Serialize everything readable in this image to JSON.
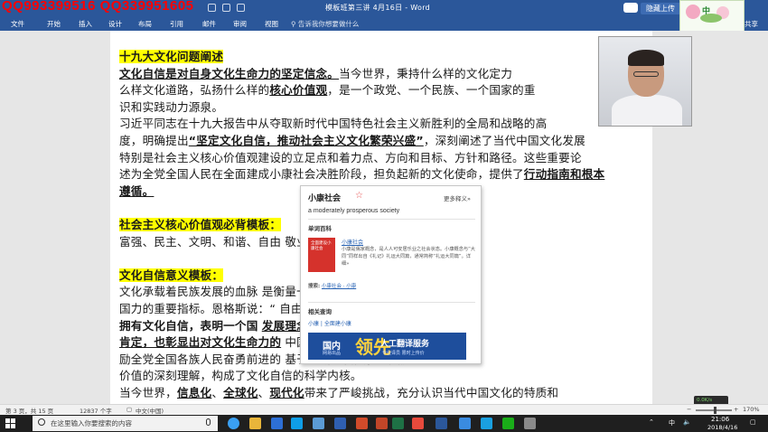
{
  "window": {
    "title": "模板班第三讲 4月16日 - Word",
    "watermark_qq": "QQ993399516  QQ339951605",
    "upload_label": "隐藏上传"
  },
  "ribbon": {
    "tabs": [
      "文件",
      "开始",
      "插入",
      "设计",
      "布局",
      "引用",
      "邮件",
      "审阅",
      "视图"
    ],
    "tell_me": "告诉我你想要做什么",
    "share": "共享"
  },
  "logo_text": "中",
  "document": {
    "lines": [
      [
        {
          "t": "十九大文化问题阐述",
          "s": "hl"
        }
      ],
      [
        {
          "t": "    "
        },
        {
          "t": "文化自信是对自身文化生命力的坚定信念。",
          "s": "b u"
        },
        {
          "t": "当今世界，秉持什么样的文化定力"
        }
      ],
      [
        {
          "t": "么样文化道路，弘扬什么样的"
        },
        {
          "t": "核心价值观",
          "s": "b u"
        },
        {
          "t": "，是一个政党、一个民族、一个国家的重"
        }
      ],
      [
        {
          "t": "识和实践动力源泉。"
        }
      ],
      [
        {
          "t": "    习近平同志在十九大报告中从夺取新时代中国特色社会主义新胜利的全局和战略的高"
        }
      ],
      [
        {
          "t": "度，明确提出"
        },
        {
          "t": "“坚定文化自信，推动社会主义文化繁荣兴盛”",
          "s": "b u"
        },
        {
          "t": "，深刻阐述了当代中国文化发展"
        }
      ],
      [
        {
          "t": "特别是社会主义核心价值观建设的立足点和着力点、方向和目标、方针和路径。这些重要论"
        }
      ],
      [
        {
          "t": "述为全党全国人民在全面建成小康社会决胜阶段，担负起新的文化使命，提供了"
        },
        {
          "t": "行动指南和根本",
          "s": "b u"
        }
      ],
      [
        {
          "t": "遵循。",
          "s": "b u"
        }
      ],
      [
        {
          "t": " "
        }
      ],
      [
        {
          "t": "社会主义核心价值观必背模板：",
          "s": "hl"
        }
      ],
      [
        {
          "t": "富强、民主、文明、和谐、自由                                  敬业、诚信、友善。"
        }
      ],
      [
        {
          "t": " "
        }
      ],
      [
        {
          "t": "    "
        },
        {
          "t": "文化自信意义模板：",
          "s": "hl"
        }
      ],
      [
        {
          "t": "    文化承载着民族发展的血脉                                  是衡量一个国家软实力和综合"
        }
      ],
      [
        {
          "t": "国力的重要指标。恩格斯说：“                                  自由的一步。”"
        }
      ],
      [
        {
          "t": "    "
        },
        {
          "t": "拥有文化自信，表明一个国",
          "s": "b"
        },
        {
          "t": "                              "
        },
        {
          "t": "发展理念、道路制度的充分",
          "s": "b u"
        }
      ],
      [
        {
          "t": "肯定，也彰显出对文化生命力的",
          "s": "b u"
        },
        {
          "t": "                              中国特色社会主义文化是激"
        }
      ],
      [
        {
          "t": "励全党全国各族人民奋勇前进的                              基于对新时代文化重大历史"
        }
      ],
      [
        {
          "t": "价值的深刻理解，构成了文化自信的科学内核。"
        }
      ],
      [
        {
          "t": "    当今世界，"
        },
        {
          "t": "信息化",
          "s": "b u"
        },
        {
          "t": "、"
        },
        {
          "t": "全球化",
          "s": "b u"
        },
        {
          "t": "、"
        },
        {
          "t": "现代化",
          "s": "b u"
        },
        {
          "t": "带来了严峻挑战，充分认识当代中国文化的特质和"
        }
      ]
    ]
  },
  "dictionary": {
    "word": "小康社会",
    "more": "更多释义»",
    "translation": "a moderately prosperous society",
    "section_baike": "单词百科",
    "image_caption": "全面建设小康社会",
    "entry_link": "小康社会",
    "entry_desc": "小康是儒家概念，是人人可安居乐业之社会状态。小康概念与“大同”同样出自《礼记》礼运大同篇，通常简称“礼运大同篇”。详细»",
    "source_label": "搜索:",
    "source_links": "小康社会 · 小康",
    "section_related": "相关查询",
    "related": "小康 | 全面建小康",
    "ad": {
      "left": "国内",
      "big": "领先",
      "right": "人工翻译服务",
      "sub_left": "网易出品",
      "sub_right": "专业译员 限时上传价"
    }
  },
  "status": {
    "page": "第 3 页，共 15 页",
    "words": "12837 个字",
    "lang": "中文(中国)",
    "zoom": "170%"
  },
  "taskbar": {
    "search_placeholder": "在这里输入你要搜索的内容",
    "time": "21:06",
    "date": "2018/4/16",
    "tray_lang": "中",
    "net_speed": "0.0K/s\n123K/s"
  },
  "colors": {
    "accent": "#2b579a",
    "highlight": "#ffff00",
    "watermark": "#ff0000"
  }
}
